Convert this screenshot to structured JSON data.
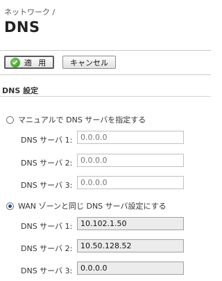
{
  "breadcrumb": "ネットワーク /",
  "page_title": "DNS",
  "toolbar": {
    "apply_label": "適 用",
    "cancel_label": "キャンセル"
  },
  "section_title": "DNS 設定",
  "manual": {
    "label": "マニュアルで DNS サーバを指定する",
    "selected": false,
    "fields": [
      {
        "label": "DNS サーバ 1:",
        "placeholder": "0.0.0.0"
      },
      {
        "label": "DNS サーバ 2:",
        "placeholder": "0.0.0.0"
      },
      {
        "label": "DNS サーバ 3:",
        "placeholder": "0.0.0.0"
      }
    ]
  },
  "wan": {
    "label": "WAN ゾーンと同じ DNS サーバ設定にする",
    "selected": true,
    "fields": [
      {
        "label": "DNS サーバ 1:",
        "value": "10.102.1.50"
      },
      {
        "label": "DNS サーバ 2:",
        "value": "10.50.128.52"
      },
      {
        "label": "DNS サーバ 3:",
        "value": "0.0.0.0"
      }
    ]
  },
  "colors": {
    "apply_icon": "#3aa02a",
    "radio_selected": "#1f4f8a",
    "readonly_bg": "#ececec"
  }
}
